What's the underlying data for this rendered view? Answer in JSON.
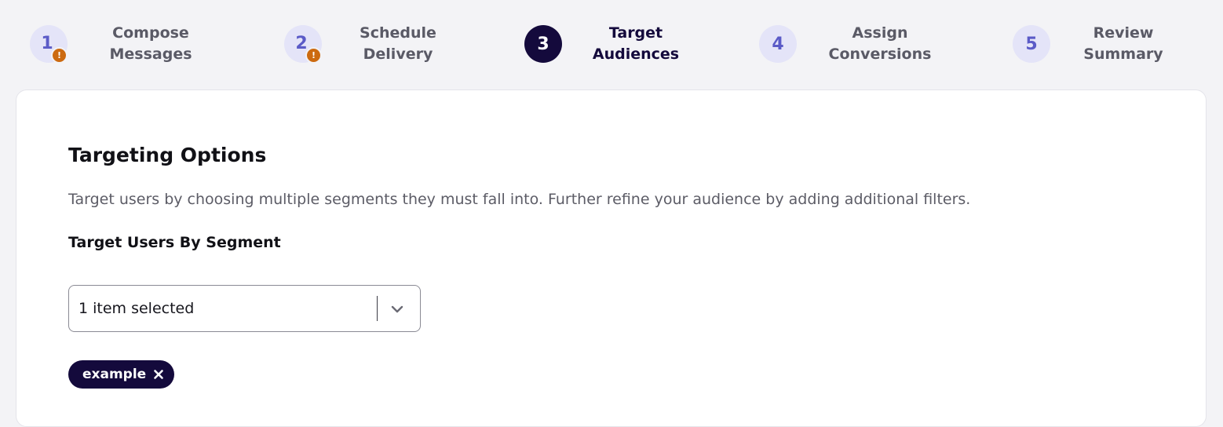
{
  "stepper": {
    "steps": [
      {
        "number": "1",
        "line1": "Compose",
        "line2": "Messages",
        "state": "warning",
        "badge": "!"
      },
      {
        "number": "2",
        "line1": "Schedule",
        "line2": "Delivery",
        "state": "warning",
        "badge": "!"
      },
      {
        "number": "3",
        "line1": "Target",
        "line2": "Audiences",
        "state": "active"
      },
      {
        "number": "4",
        "line1": "Assign",
        "line2": "Conversions",
        "state": "inactive"
      },
      {
        "number": "5",
        "line1": "Review",
        "line2": "Summary",
        "state": "inactive"
      }
    ]
  },
  "targeting": {
    "title": "Targeting Options",
    "description": "Target users by choosing multiple segments they must fall into. Further refine your audience by adding additional filters.",
    "segment_label": "Target Users By Segment",
    "segment_select": {
      "value": "1 item selected",
      "icon": "chevron-down-icon"
    },
    "selected_segments": [
      {
        "label": "example",
        "remove_icon": "close-icon"
      }
    ]
  },
  "colors": {
    "page_background": "#f3f3f6",
    "active_step": "#140a3c",
    "inactive_step_bg": "#e4e4f8",
    "inactive_step_text": "#5b5bc7",
    "warning_badge": "#cc6a10",
    "chip_background": "#140a3c"
  }
}
